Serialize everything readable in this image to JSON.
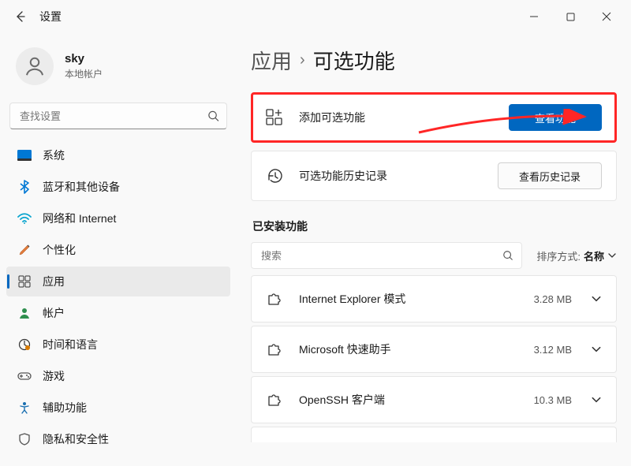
{
  "titlebar": {
    "title": "设置"
  },
  "account": {
    "name": "sky",
    "subtitle": "本地帐户"
  },
  "sidebar": {
    "search_placeholder": "查找设置",
    "items": [
      {
        "label": "系统"
      },
      {
        "label": "蓝牙和其他设备"
      },
      {
        "label": "网络和 Internet"
      },
      {
        "label": "个性化"
      },
      {
        "label": "应用"
      },
      {
        "label": "帐户"
      },
      {
        "label": "时间和语言"
      },
      {
        "label": "游戏"
      },
      {
        "label": "辅助功能"
      },
      {
        "label": "隐私和安全性"
      }
    ]
  },
  "breadcrumb": {
    "parent": "应用",
    "current": "可选功能"
  },
  "cards": {
    "add": {
      "label": "添加可选功能",
      "button": "查看功能"
    },
    "history": {
      "label": "可选功能历史记录",
      "button": "查看历史记录"
    }
  },
  "installed": {
    "heading": "已安装功能",
    "search_placeholder": "搜索",
    "sort_prefix": "排序方式:",
    "sort_value": "名称",
    "items": [
      {
        "name": "Internet Explorer 模式",
        "size": "3.28 MB"
      },
      {
        "name": "Microsoft 快速助手",
        "size": "3.12 MB"
      },
      {
        "name": "OpenSSH 客户端",
        "size": "10.3 MB"
      }
    ]
  }
}
